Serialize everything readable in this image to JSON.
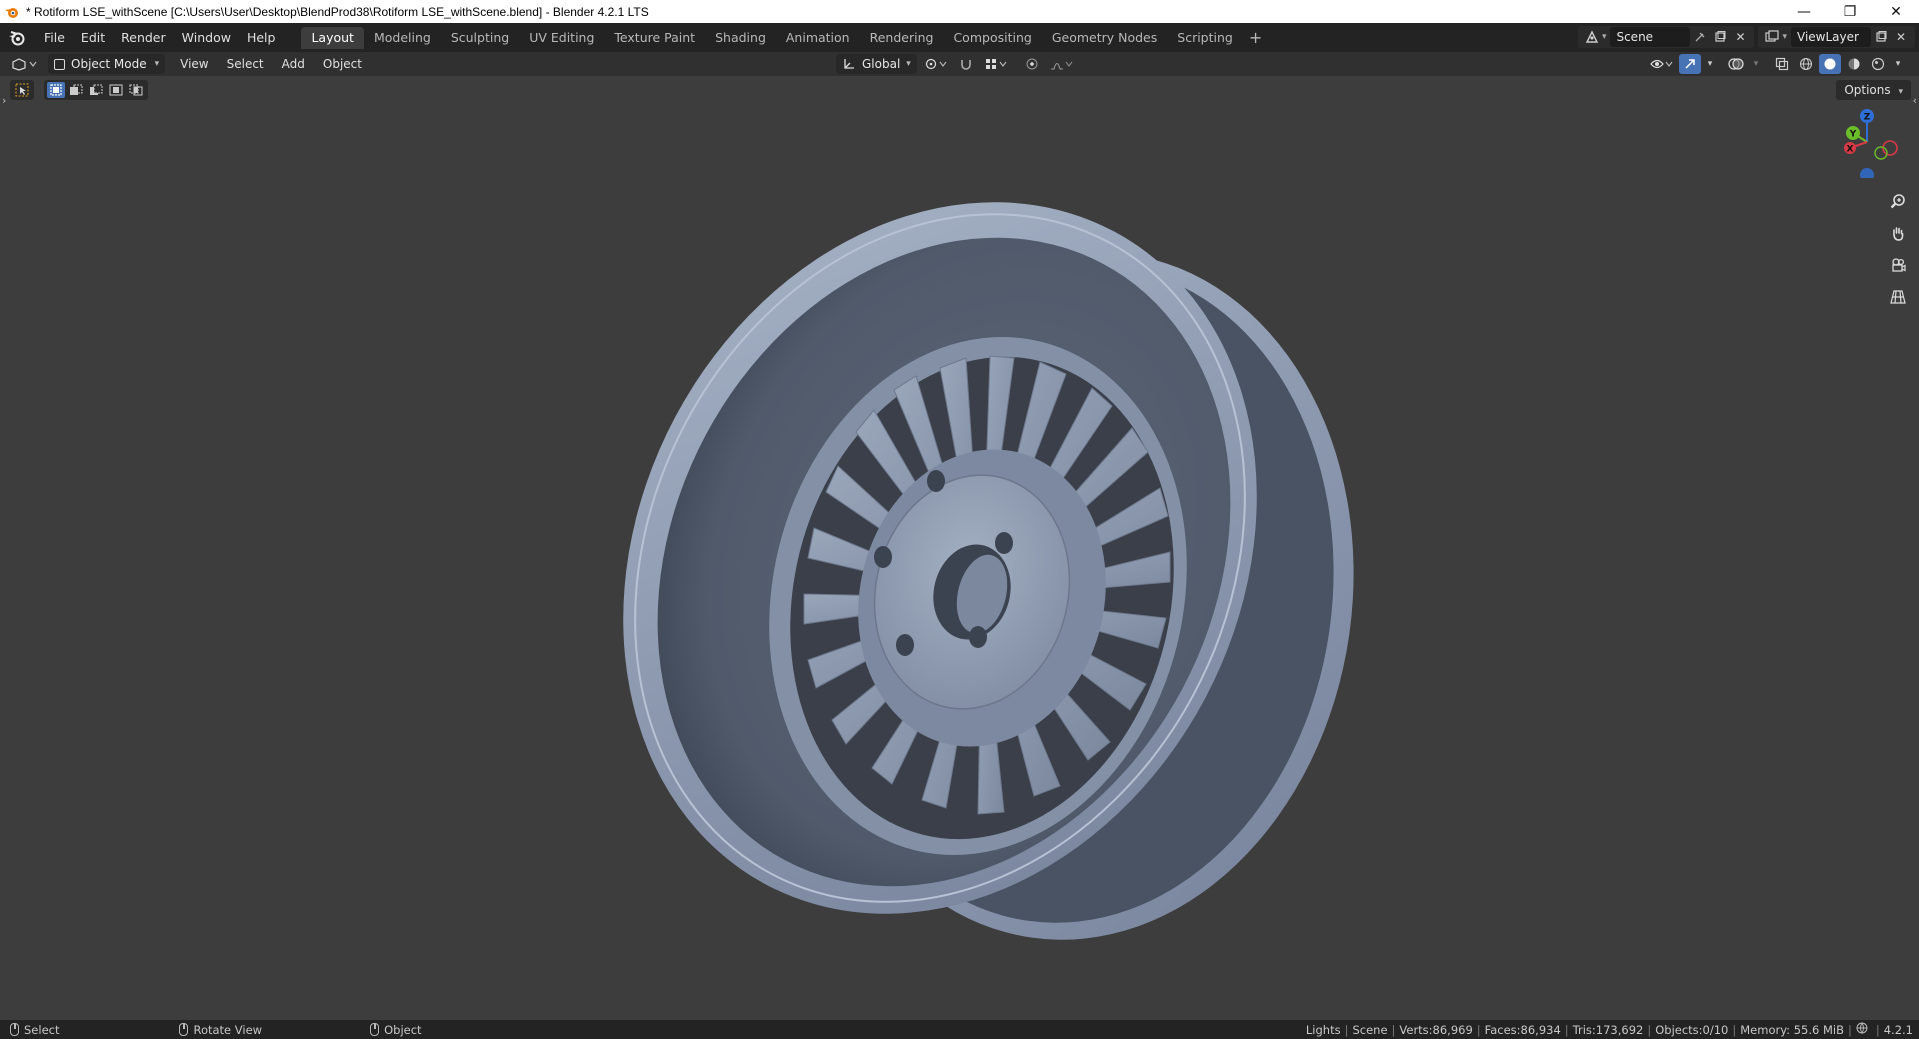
{
  "window": {
    "title": "* Rotiform LSE_withScene [C:\\Users\\User\\Desktop\\BlendProd38\\Rotiform LSE_withScene.blend] - Blender 4.2.1 LTS",
    "minimize": "—",
    "restore": "❐",
    "close": "✕"
  },
  "topbar": {
    "menus": [
      "File",
      "Edit",
      "Render",
      "Window",
      "Help"
    ],
    "workspaces": [
      "Layout",
      "Modeling",
      "Sculpting",
      "UV Editing",
      "Texture Paint",
      "Shading",
      "Animation",
      "Rendering",
      "Compositing",
      "Geometry Nodes",
      "Scripting"
    ],
    "active_workspace": "Layout",
    "add_workspace": "+",
    "scene_name": "Scene",
    "view_layer": "ViewLayer"
  },
  "viewport_header": {
    "mode": "Object Mode",
    "menus": [
      "View",
      "Select",
      "Add",
      "Object"
    ],
    "transform_orientation": "Global"
  },
  "viewport": {
    "options_label": "Options",
    "gizmo_axes": {
      "z": "Z",
      "y": "Y",
      "x": "X"
    },
    "object_color": "#8a97ad",
    "background_color": "#3d3d3d"
  },
  "statusbar": {
    "hints": [
      {
        "label": "Select"
      },
      {
        "label": "Rotate View"
      },
      {
        "label": "Object"
      }
    ],
    "stats": {
      "collection": "Lights",
      "scene": "Scene",
      "verts": "Verts:86,969",
      "faces": "Faces:86,934",
      "tris": "Tris:173,692",
      "objects": "Objects:0/10",
      "memory": "Memory: 55.6 MiB",
      "version": "4.2.1"
    }
  }
}
